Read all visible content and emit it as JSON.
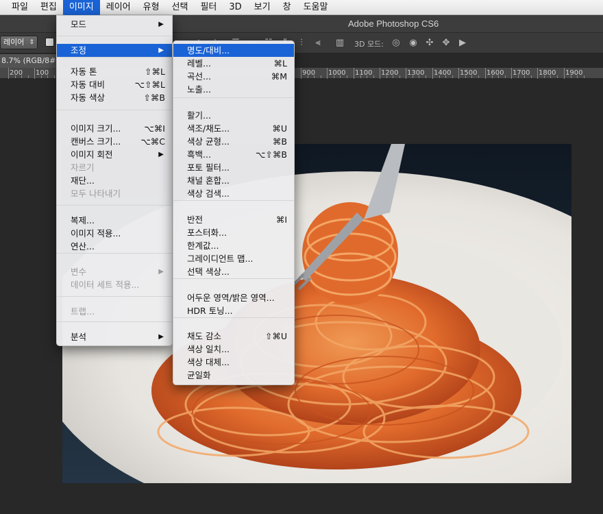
{
  "menubar": {
    "items": [
      "파일",
      "편집",
      "이미지",
      "레이어",
      "유형",
      "선택",
      "필터",
      "3D",
      "보기",
      "창",
      "도움말"
    ],
    "active_index": 2
  },
  "app": {
    "title": "Adobe Photoshop CS6"
  },
  "options": {
    "layer_select": "레이어",
    "label_3d": "3D 모드:"
  },
  "document": {
    "tab": "8.7% (RGB/8#)"
  },
  "ruler": {
    "ticks": [
      "200",
      "100",
      "900",
      "1000",
      "1100",
      "1200",
      "1300",
      "1400",
      "1500",
      "1600",
      "1700",
      "1800",
      "1900"
    ]
  },
  "image_menu": {
    "items": [
      {
        "label": "모드",
        "shortcut": "",
        "submenu": true,
        "disabled": false
      },
      {
        "label": "조정",
        "shortcut": "",
        "submenu": true,
        "disabled": false,
        "highlight": true
      },
      {
        "label": "자동 톤",
        "shortcut": "⇧⌘L",
        "submenu": false,
        "disabled": false
      },
      {
        "label": "자동 대비",
        "shortcut": "⌥⇧⌘L",
        "submenu": false,
        "disabled": false
      },
      {
        "label": "자동 색상",
        "shortcut": "⇧⌘B",
        "submenu": false,
        "disabled": false
      },
      {
        "label": "이미지 크기...",
        "shortcut": "⌥⌘I",
        "submenu": false,
        "disabled": false
      },
      {
        "label": "캔버스 크기...",
        "shortcut": "⌥⌘C",
        "submenu": false,
        "disabled": false
      },
      {
        "label": "이미지 회전",
        "shortcut": "",
        "submenu": true,
        "disabled": false
      },
      {
        "label": "자르기",
        "shortcut": "",
        "submenu": false,
        "disabled": true
      },
      {
        "label": "재단...",
        "shortcut": "",
        "submenu": false,
        "disabled": false
      },
      {
        "label": "모두 나타내기",
        "shortcut": "",
        "submenu": false,
        "disabled": true
      },
      {
        "label": "복제...",
        "shortcut": "",
        "submenu": false,
        "disabled": false
      },
      {
        "label": "이미지 적용...",
        "shortcut": "",
        "submenu": false,
        "disabled": false
      },
      {
        "label": "연산...",
        "shortcut": "",
        "submenu": false,
        "disabled": false
      },
      {
        "label": "변수",
        "shortcut": "",
        "submenu": true,
        "disabled": true
      },
      {
        "label": "데이터 세트 적용...",
        "shortcut": "",
        "submenu": false,
        "disabled": true
      },
      {
        "label": "트랩...",
        "shortcut": "",
        "submenu": false,
        "disabled": true
      },
      {
        "label": "분석",
        "shortcut": "",
        "submenu": true,
        "disabled": false
      }
    ]
  },
  "adjust_menu": {
    "items": [
      {
        "label": "명도/대비...",
        "shortcut": "",
        "highlight": true
      },
      {
        "label": "레벨...",
        "shortcut": "⌘L"
      },
      {
        "label": "곡선...",
        "shortcut": "⌘M"
      },
      {
        "label": "노출...",
        "shortcut": ""
      },
      {
        "label": "활기...",
        "shortcut": ""
      },
      {
        "label": "색조/채도...",
        "shortcut": "⌘U"
      },
      {
        "label": "색상 균형...",
        "shortcut": "⌘B"
      },
      {
        "label": "흑백...",
        "shortcut": "⌥⇧⌘B"
      },
      {
        "label": "포토 필터...",
        "shortcut": ""
      },
      {
        "label": "채널 혼합...",
        "shortcut": ""
      },
      {
        "label": "색상 검색...",
        "shortcut": ""
      },
      {
        "label": "반전",
        "shortcut": "⌘I"
      },
      {
        "label": "포스터화...",
        "shortcut": ""
      },
      {
        "label": "한계값...",
        "shortcut": ""
      },
      {
        "label": "그레이디언트 맵...",
        "shortcut": ""
      },
      {
        "label": "선택 색상...",
        "shortcut": ""
      },
      {
        "label": "어두운 영역/밝은 영역...",
        "shortcut": ""
      },
      {
        "label": "HDR 토닝...",
        "shortcut": ""
      },
      {
        "label": "채도 감소",
        "shortcut": "⇧⌘U"
      },
      {
        "label": "색상 일치...",
        "shortcut": ""
      },
      {
        "label": "색상 대체...",
        "shortcut": ""
      },
      {
        "label": "균일화",
        "shortcut": ""
      }
    ]
  }
}
